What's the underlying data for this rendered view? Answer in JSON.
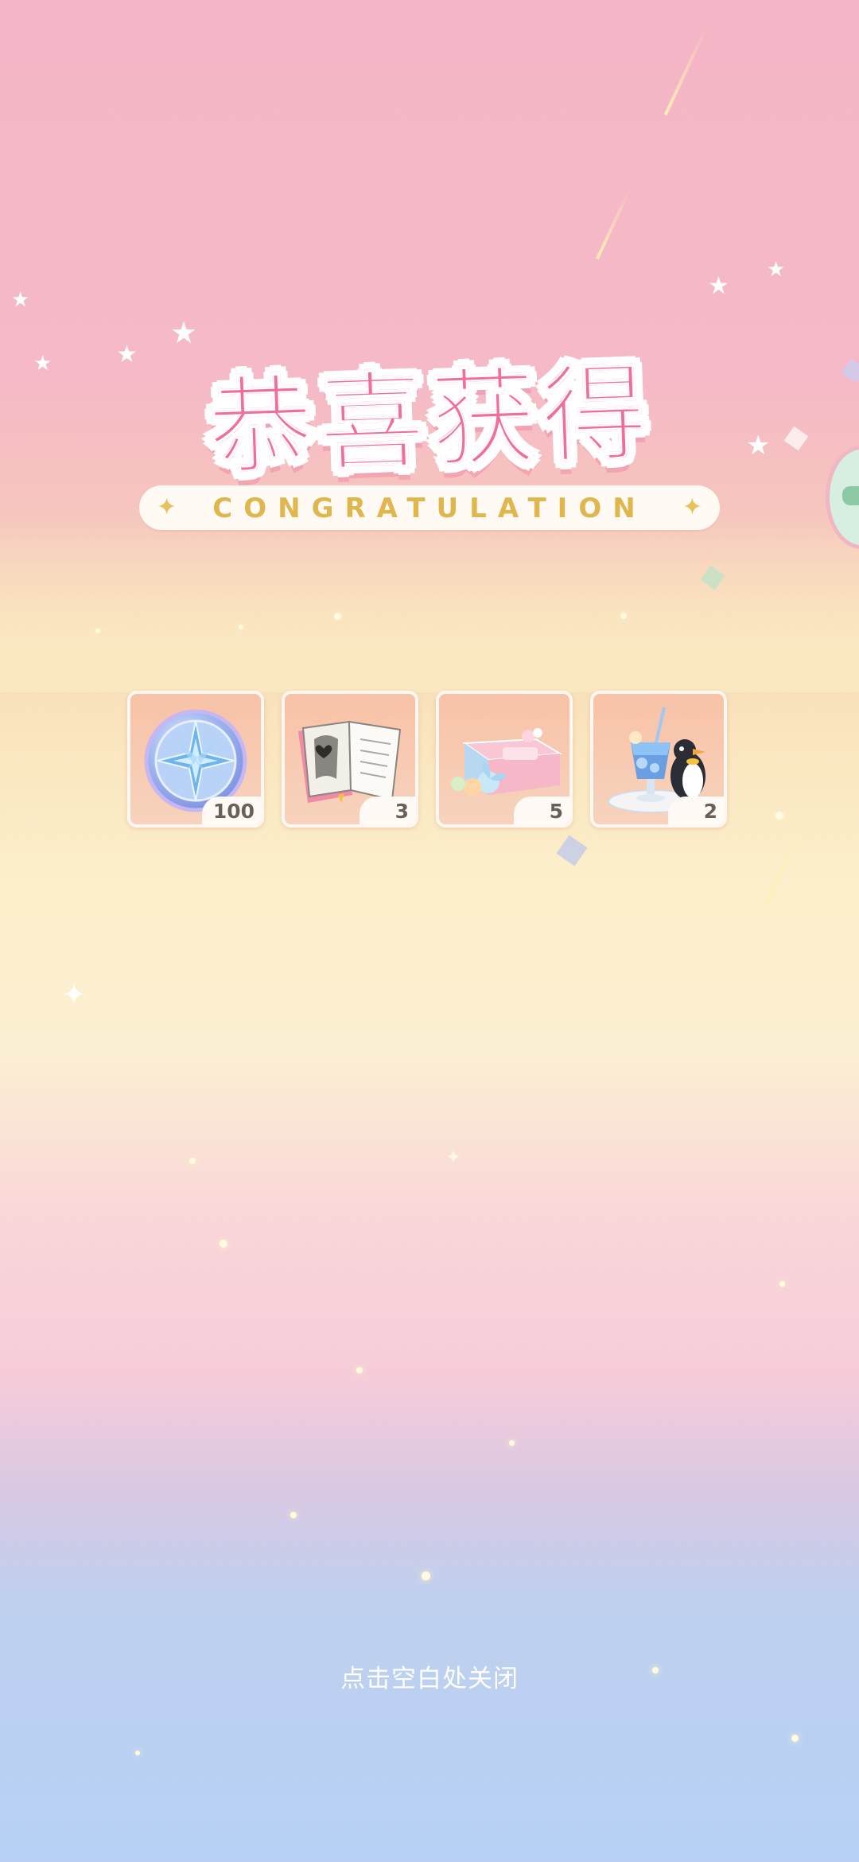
{
  "title": {
    "main": "恭喜获得",
    "subtitle": "CONGRATULATION"
  },
  "rewards": [
    {
      "icon": "star-coin-icon",
      "count": "100"
    },
    {
      "icon": "open-book-icon",
      "count": "3"
    },
    {
      "icon": "gift-box-icon",
      "count": "5"
    },
    {
      "icon": "penguin-drink-icon",
      "count": "2"
    }
  ],
  "footer": {
    "close_hint": "点击空白处关闭"
  },
  "colors": {
    "title_pink": "#ef6f98",
    "subtitle_gold": "#e0b64e",
    "count_text": "#6b5f59"
  }
}
